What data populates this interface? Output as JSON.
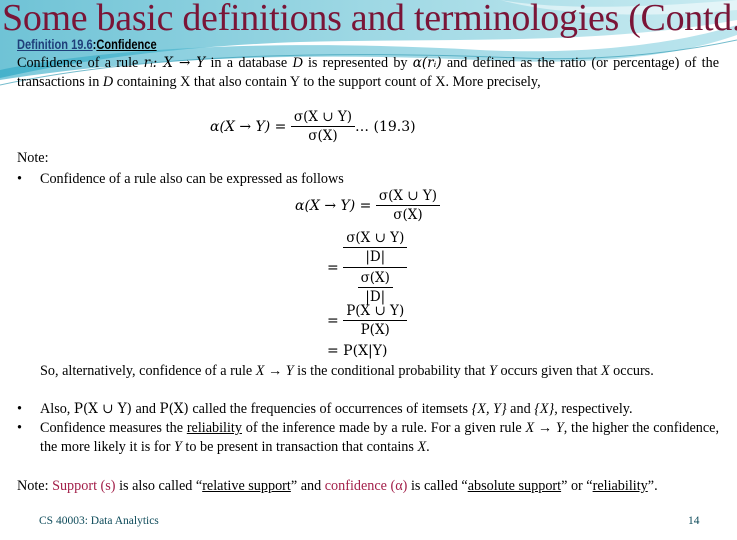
{
  "title": "Some basic definitions and terminologies (Contd..)",
  "definition": {
    "number": "Definition 19.6",
    "colon": ":",
    "name": "Confidence"
  },
  "paragraph1": {
    "a": "Confidence of a rule ",
    "rule": "rᵢ: X → Y",
    "b": " in a database ",
    "db": "D",
    "c": " is represented by ",
    "alpha": "α(rᵢ)",
    "d": " and defined as the ratio (or percentage) of the transactions in ",
    "db2": "D",
    "e": " containing X that also contain Y to the support count of X. More precisely,"
  },
  "eq1": {
    "lhs": "α(X → Y) =",
    "num": "σ(X ∪ Y)",
    "den": "σ(X)",
    "tag": "… (19.3)"
  },
  "note_label": "Note:",
  "bullets": [
    {
      "symbol": "•",
      "text": "Confidence of a rule also can be expressed as follows"
    },
    {
      "symbol": "•"
    },
    {
      "symbol": "•"
    }
  ],
  "eq2": {
    "lhs": "α(X → Y) =",
    "num": "σ(X ∪ Y)",
    "den": "σ(X)",
    "eq": "=",
    "inner_num_top": "σ(X ∪ Y)",
    "inner_num_bot": "|D|",
    "inner_den_top": "σ(X)",
    "inner_den_bot": "|D|",
    "p_num": "P(X ∪ Y)",
    "p_den": "P(X)",
    "final": "= P(X|Y)"
  },
  "alternatively": {
    "a": "So, alternatively, confidence of a rule ",
    "rule": "X → Y",
    "b": " is the conditional probability that ",
    "y": "Y",
    "c": " occurs given that ",
    "x": "X",
    "d": " occurs."
  },
  "also": {
    "a": "Also, ",
    "p1": "P(X ∪ Y)",
    "b": " and ",
    "p2": "P(X)",
    "c": " called the frequencies of occurrences of itemsets ",
    "s1": "{X, Y}",
    "d": " and ",
    "s2": "{X}",
    "e": ", respectively."
  },
  "measures": {
    "a": "Confidence measures the ",
    "rel": "reliability",
    "b": " of the inference made by a rule. For a given rule ",
    "rule": "X → Y",
    "c": ", the higher the confidence, the more likely it is for ",
    "y": "Y",
    "d": " to be present in transaction that contains ",
    "x": "X",
    "e": "."
  },
  "final_note": {
    "label": "Note: ",
    "support": "Support (s)",
    "a": " is also called “",
    "rel_support": "relative support",
    "b": "” and ",
    "confidence": "confidence (α)",
    "c": " is called “",
    "abs_support": "absolute support",
    "d": "” or “",
    "reliability": "reliability",
    "e": "”."
  },
  "footer": {
    "course": "CS 40003: Data Analytics",
    "page": "14"
  },
  "colors": {
    "title": "#7a1537",
    "accent_red": "#a3204a",
    "def_blue": "#1f3f7a",
    "footer": "#0e4b5a"
  }
}
